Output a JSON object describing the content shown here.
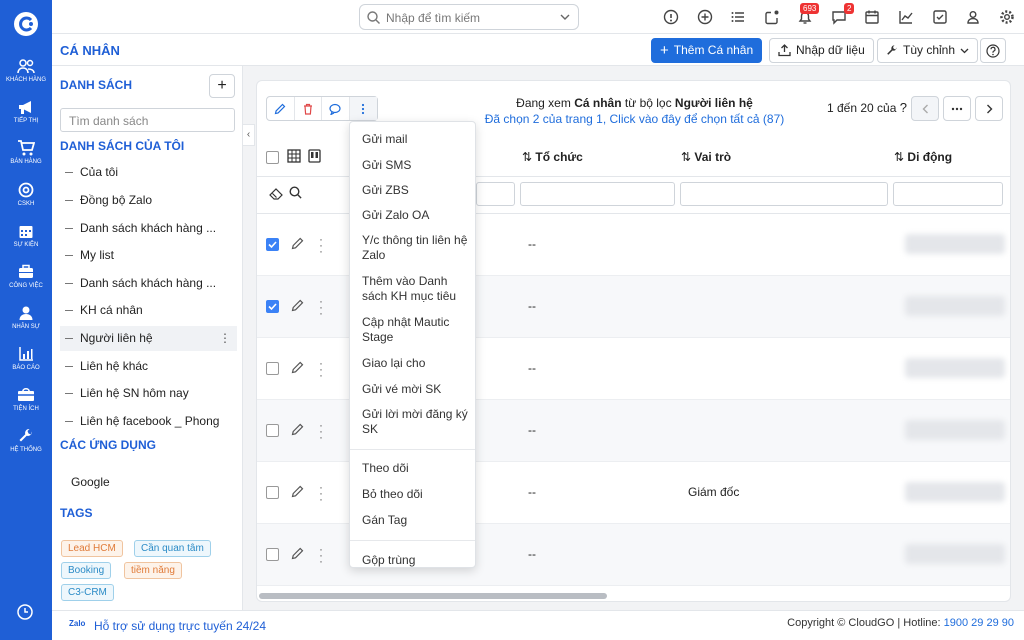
{
  "nav": {
    "items": [
      {
        "label": "KHÁCH HÀNG",
        "icon": "users-icon"
      },
      {
        "label": "TIẾP THỊ",
        "icon": "megaphone-icon"
      },
      {
        "label": "BÁN HÀNG",
        "icon": "cart-icon"
      },
      {
        "label": "CSKH",
        "icon": "lifebuoy-icon"
      },
      {
        "label": "SỰ KIỆN",
        "icon": "calendar-icon"
      },
      {
        "label": "CÔNG VIỆC",
        "icon": "briefcase-icon"
      },
      {
        "label": "NHÂN SỰ",
        "icon": "person-icon"
      },
      {
        "label": "BÁO CÁO",
        "icon": "chart-icon"
      },
      {
        "label": "TIỆN ÍCH",
        "icon": "package-icon"
      },
      {
        "label": "HỆ THỐNG",
        "icon": "wrench-icon"
      }
    ]
  },
  "topbar": {
    "search_placeholder": "Nhập để tìm kiếm",
    "notification_count": "693",
    "message_count": "2"
  },
  "header": {
    "title": "CÁ NHÂN",
    "add_button": "Thêm Cá nhân",
    "import_button": "Nhập dữ liệu",
    "customize_button": "Tùy chỉnh"
  },
  "sidebar": {
    "list_title": "DANH SÁCH",
    "search_placeholder": "Tìm danh sách",
    "my_lists_title": "DANH SÁCH CỦA TÔI",
    "items": [
      "Của tôi",
      "Đồng bộ Zalo",
      "Danh sách khách hàng ...",
      "My list",
      "Danh sách khách hàng ...",
      "KH cá nhân",
      "Người liên hệ",
      "Liên hệ khác",
      "Liên hệ SN hôm nay",
      "Liên hệ facebook _ Phong"
    ],
    "apps_title": "CÁC ỨNG DỤNG",
    "apps": [
      "Google"
    ],
    "tags_title": "TAGS",
    "tags": [
      {
        "label": "Lead HCM",
        "color": "#e07b39"
      },
      {
        "label": "Cần quan tâm",
        "color": "#2b8bc6"
      },
      {
        "label": "Booking",
        "color": "#2b8bc6"
      },
      {
        "label": "tiềm năng",
        "color": "#e07b39"
      },
      {
        "label": "C3-CRM",
        "color": "#2b8bc6"
      }
    ]
  },
  "main": {
    "viewing_prefix": "Đang xem ",
    "viewing_module": "Cá nhân",
    "viewing_mid": " từ bộ lọc ",
    "viewing_filter": "Người liên hệ",
    "selected_text": "Đã chọn 2 của trang 1, Click vào đây để chọn tất cả (87)",
    "pager_text": "1 đến 20 của",
    "pager_q": "?",
    "columns": [
      "Tổ chức",
      "Vai trò",
      "Di động"
    ],
    "rows": [
      {
        "checked": true,
        "org": "--",
        "role": ""
      },
      {
        "checked": true,
        "org": "--",
        "role": ""
      },
      {
        "checked": false,
        "org": "--",
        "role": ""
      },
      {
        "checked": false,
        "org": "--",
        "role": ""
      },
      {
        "checked": false,
        "org": "--",
        "role": "Giám đốc"
      },
      {
        "checked": false,
        "org": "--",
        "role": ""
      }
    ]
  },
  "dropdown": {
    "items": [
      "Gửi mail",
      "Gửi SMS",
      "Gửi ZBS",
      "Gửi Zalo OA",
      "Y/c thông tin liên hệ Zalo",
      "Thêm vào Danh sách KH mục tiêu",
      "Cập nhật Mautic Stage",
      "Giao lại cho",
      "Gửi vé mời SK",
      "Gửi lời mời đăng ký SK",
      "Theo dõi",
      "Bỏ theo dõi",
      "Gán Tag",
      "Gộp trùng"
    ]
  },
  "footer": {
    "zalo": "Zalo",
    "support": "Hỗ trợ sử dụng trực tuyến 24/24",
    "copyright": "Copyright © CloudGO",
    "hotline_label": "Hotline:",
    "hotline": "1900 29 29 90"
  }
}
